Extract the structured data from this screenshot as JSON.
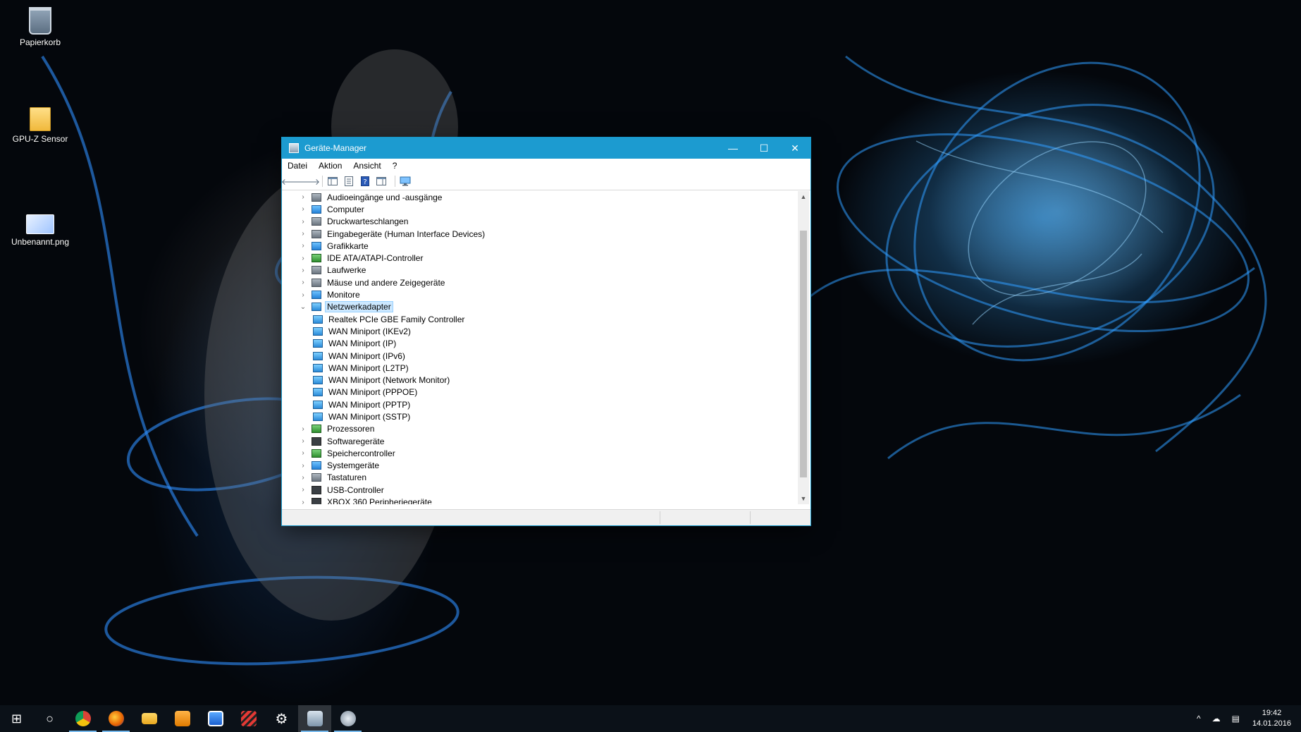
{
  "desktop": {
    "icons": [
      {
        "label": "Papierkorb"
      },
      {
        "label": "GPU-Z Sensor"
      },
      {
        "label": "Unbenannt.png"
      }
    ]
  },
  "window": {
    "title": "Geräte-Manager",
    "controls": {
      "minimize": "—",
      "maximize": "☐",
      "close": "✕"
    },
    "menu": [
      "Datei",
      "Aktion",
      "Ansicht",
      "?"
    ],
    "toolbar": {
      "back": "🡐",
      "forward": "🡒",
      "help": "?"
    },
    "tree": {
      "categories_before": [
        "Audioeingänge und -ausgänge",
        "Computer",
        "Druckwarteschlangen",
        "Eingabegeräte (Human Interface Devices)",
        "Grafikkarte",
        "IDE ATA/ATAPI-Controller",
        "Laufwerke",
        "Mäuse und andere Zeigegeräte",
        "Monitore"
      ],
      "expanded": {
        "label": "Netzwerkadapter",
        "children": [
          "Realtek PCIe GBE Family Controller",
          "WAN Miniport (IKEv2)",
          "WAN Miniport (IP)",
          "WAN Miniport (IPv6)",
          "WAN Miniport (L2TP)",
          "WAN Miniport (Network Monitor)",
          "WAN Miniport (PPPOE)",
          "WAN Miniport (PPTP)",
          "WAN Miniport (SSTP)"
        ]
      },
      "categories_after": [
        "Prozessoren",
        "Softwaregeräte",
        "Speichercontroller",
        "Systemgeräte",
        "Tastaturen",
        "USB-Controller",
        "XBOX 360 Peripheriegeräte"
      ]
    },
    "glyphs": {
      "collapsed": "›",
      "expanded": "⌄",
      "scroll_up": "▲",
      "scroll_down": "▼"
    }
  },
  "taskbar": {
    "start": "⊞",
    "search": "○",
    "tray": {
      "chevron": "^",
      "cloud": "☁",
      "notifications": "▤"
    },
    "clock": {
      "time": "19:42",
      "date": "14.01.2016"
    }
  },
  "colors": {
    "titlebar": "#1c9bd0",
    "selection": "#cce8ff",
    "taskbar": "#0c121a"
  }
}
